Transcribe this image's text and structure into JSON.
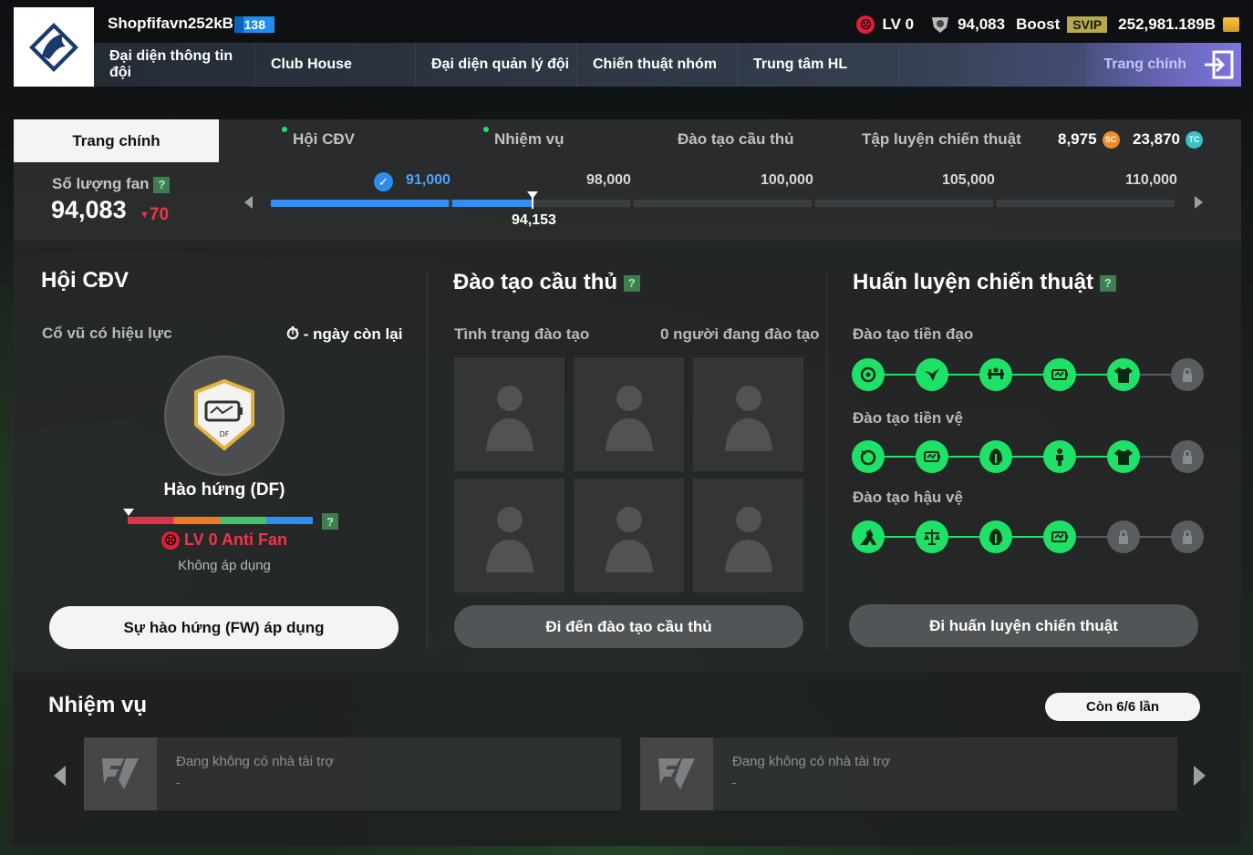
{
  "header": {
    "username": "Shopfifavn252kBP",
    "level_badge": "138",
    "team_level": "LV 0",
    "fan_count": "94,083",
    "boost_label": "Boost",
    "svip_label": "SVIP",
    "balance": "252,981.189B"
  },
  "nav": {
    "items": [
      {
        "label": "Đại diện thông tin đội"
      },
      {
        "label": "Club House"
      },
      {
        "label": "Đại diện quản lý đội"
      },
      {
        "label": "Chiến thuật nhóm"
      },
      {
        "label": "Trung tâm HL"
      }
    ],
    "home_label": "Trang chính"
  },
  "tabs": {
    "active": "Trang chính",
    "items": [
      "Hội CĐV",
      "Nhiệm vụ",
      "Đào tạo cầu thủ",
      "Tập luyện chiến thuật"
    ],
    "sc_value": "8,975",
    "sc_icon": "SC",
    "tc_value": "23,870",
    "tc_icon": "TC"
  },
  "fans": {
    "label": "Số lượng fan",
    "help": "?",
    "value": "94,083",
    "delta": "70",
    "delta_arrow": "▼",
    "milestones": [
      "91,000",
      "98,000",
      "100,000",
      "105,000",
      "110,000"
    ],
    "current": "94,153",
    "progress_fraction": 0.29
  },
  "fan_club": {
    "title": "Hội CĐV",
    "cheer_label": "Cổ vũ có hiệu lực",
    "days_left": "- ngày còn lại",
    "badge_text": "DF",
    "buff_name": "Hào hứng (DF)",
    "help": "?",
    "level_text": "LV 0 Anti Fan",
    "status": "Không áp dụng",
    "button": "Sự hào hứng (FW) áp dụng"
  },
  "training": {
    "title": "Đào tạo cầu thủ",
    "help": "?",
    "status_label": "Tình trạng đào tạo",
    "count_label": "0 người đang đào tạo",
    "button": "Đi đến đào tạo cầu thủ"
  },
  "tactics": {
    "title": "Huấn luyện chiến thuật",
    "help": "?",
    "rows": [
      {
        "label": "Đào tạo tiền đạo",
        "icons": [
          "ball-kick-icon",
          "bird-icon",
          "weightlift-icon",
          "battery-icon",
          "jersey-icon",
          "lock-icon"
        ],
        "unlocked": 5
      },
      {
        "label": "Đào tạo tiền vệ",
        "icons": [
          "ball-dribble-icon",
          "battery-icon",
          "helmet-icon",
          "person-icon",
          "jersey-icon",
          "lock-icon"
        ],
        "unlocked": 5
      },
      {
        "label": "Đào tạo hậu vệ",
        "icons": [
          "kangaroo-icon",
          "scale-icon",
          "helmet-icon",
          "battery-icon",
          "lock-icon",
          "lock-icon"
        ],
        "unlocked": 4
      }
    ],
    "button": "Đi huấn luyện chiến thuật"
  },
  "missions": {
    "title": "Nhiệm vụ",
    "remaining": "Còn 6/6 lần",
    "cards": [
      {
        "text": "Đang không có nhà tài trợ",
        "sub": "-"
      },
      {
        "text": "Đang không có nhà tài trợ",
        "sub": "-"
      }
    ]
  },
  "colors": {
    "accent_green": "#1ee268",
    "accent_blue": "#2f8ff2",
    "anti_fan_red": "#f2334c"
  }
}
